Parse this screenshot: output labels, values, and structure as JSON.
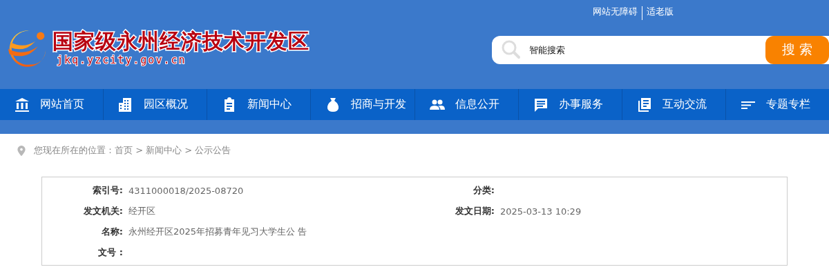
{
  "top_links": [
    "网站无障碍",
    "适老版"
  ],
  "logo": {
    "title": "国家级永州经济技术开发区",
    "domain": "jkq.yzcity.gov.cn"
  },
  "search": {
    "placeholder": "智能搜索",
    "button": "搜 索"
  },
  "nav": [
    {
      "label": "网站首页"
    },
    {
      "label": "园区概况"
    },
    {
      "label": "新闻中心"
    },
    {
      "label": "招商与开发"
    },
    {
      "label": "信息公开"
    },
    {
      "label": "办事服务"
    },
    {
      "label": "互动交流"
    },
    {
      "label": "专题专栏"
    }
  ],
  "breadcrumb": "您现在所在的位置：首页 > 新闻中心 > 公示公告",
  "info": [
    {
      "label": "索引号:",
      "value": "4311000018/2025-08720",
      "label2": "分类:"
    },
    {
      "label": "发文机关:",
      "value": "经开区",
      "label2": "发文日期:",
      "value2": "2025-03-13 10:29"
    },
    {
      "label": "名称:",
      "value": "永州经开区2025年招募青年见习大学生公 告"
    },
    {
      "label": "文号 :"
    }
  ]
}
